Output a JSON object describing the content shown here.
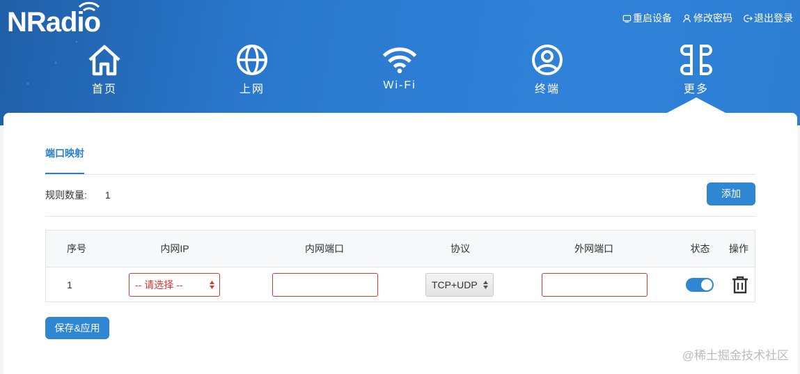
{
  "logo": {
    "text": "NRadio",
    "icon": "wifi-icon"
  },
  "top_links": [
    {
      "label": "重启设备",
      "icon": "restart-icon"
    },
    {
      "label": "修改密码",
      "icon": "user-key-icon"
    },
    {
      "label": "退出登录",
      "icon": "logout-icon"
    }
  ],
  "nav": [
    {
      "label": "首页",
      "icon": "home-icon"
    },
    {
      "label": "上网",
      "icon": "globe-icon"
    },
    {
      "label": "Wi-Fi",
      "icon": "wifi-icon"
    },
    {
      "label": "终端",
      "icon": "user-circle-icon"
    },
    {
      "label": "更多",
      "icon": "more-grid-icon",
      "active": true
    }
  ],
  "tab": {
    "label": "端口映射"
  },
  "rules": {
    "count_label": "规则数量:",
    "count_value": "1",
    "add_label": "添加"
  },
  "table": {
    "columns": [
      "序号",
      "内网IP",
      "内网端口",
      "协议",
      "外网端口",
      "状态",
      "操作"
    ],
    "rows": [
      {
        "index": "1",
        "internal_ip": "-- 请选择 --",
        "internal_port": "",
        "protocol": "TCP+UDP",
        "external_port": "",
        "enabled": true,
        "action_icon": "trash-icon"
      }
    ]
  },
  "save": {
    "label": "保存&应用"
  },
  "watermark": "@稀土掘金技术社区",
  "colors": {
    "accent": "#2f86d2",
    "error": "#d9362f",
    "header": "#2a79cf"
  }
}
